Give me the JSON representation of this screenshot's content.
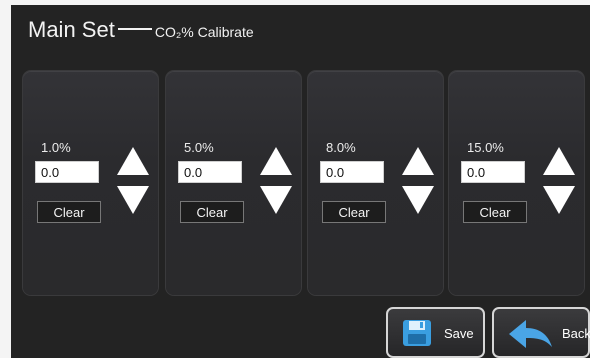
{
  "header": {
    "title_main": "Main Set",
    "title_sub": "CO₂% Calibrate"
  },
  "panels": [
    {
      "percent": "1.0%",
      "value": "0.0",
      "clear_label": "Clear"
    },
    {
      "percent": "5.0%",
      "value": "0.0",
      "clear_label": "Clear"
    },
    {
      "percent": "8.0%",
      "value": "0.0",
      "clear_label": "Clear"
    },
    {
      "percent": "15.0%",
      "value": "0.0",
      "clear_label": "Clear"
    }
  ],
  "footer": {
    "save_label": "Save",
    "back_label": "Back"
  },
  "icons": {
    "save": "floppy-disk-icon",
    "back": "back-arrow-icon",
    "increase": "triangle-up-icon",
    "decrease": "triangle-down-icon"
  },
  "colors": {
    "background": "#232323",
    "panel": "#2d2d30",
    "text": "#f2f2f2",
    "save_icon": "#3a9ee0",
    "back_icon": "#4aa5e6"
  }
}
